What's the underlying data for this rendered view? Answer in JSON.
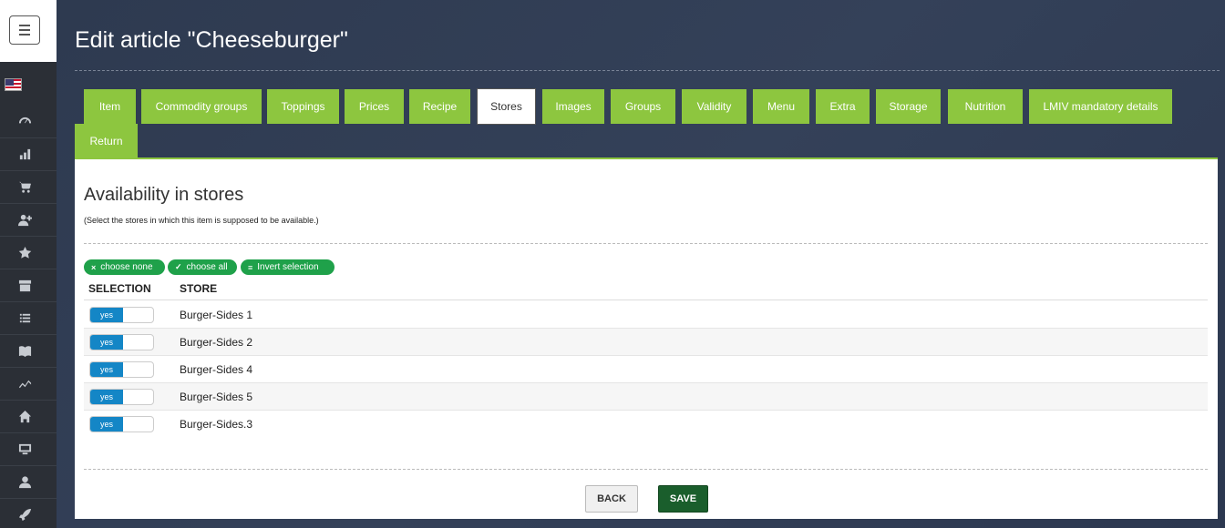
{
  "sidebar": {
    "language": "en-US",
    "items": [
      {
        "icon": "dashboard-icon"
      },
      {
        "icon": "bar-chart-icon"
      },
      {
        "icon": "cart-icon"
      },
      {
        "icon": "add-user-icon"
      },
      {
        "icon": "star-icon"
      },
      {
        "icon": "archive-icon"
      },
      {
        "icon": "list-icon"
      },
      {
        "icon": "book-icon"
      },
      {
        "icon": "trend-icon"
      },
      {
        "icon": "home-icon"
      },
      {
        "icon": "monitor-icon"
      },
      {
        "icon": "user-icon"
      },
      {
        "icon": "rocket-icon"
      }
    ]
  },
  "page": {
    "title": "Edit article \"Cheeseburger\""
  },
  "tabs": [
    {
      "label": "Item"
    },
    {
      "label": "Commodity groups"
    },
    {
      "label": "Toppings"
    },
    {
      "label": "Prices"
    },
    {
      "label": "Recipe"
    },
    {
      "label": "Stores",
      "active": true
    },
    {
      "label": "Images"
    },
    {
      "label": "Groups"
    },
    {
      "label": "Validity"
    },
    {
      "label": "Menu"
    },
    {
      "label": "Extra"
    },
    {
      "label": "Storage"
    },
    {
      "label": "Nutrition"
    },
    {
      "label": "LMIV mandatory details"
    },
    {
      "label": "Return"
    }
  ],
  "section": {
    "title": "Availability in stores",
    "hint": "(Select the stores in which this item is supposed to be available.)"
  },
  "actions": {
    "choose_none": {
      "icon": "×",
      "label": "choose none"
    },
    "choose_all": {
      "icon": "✓",
      "label": "choose all"
    },
    "invert": {
      "icon": "≡",
      "label": "Invert selection"
    }
  },
  "table": {
    "headers": {
      "selection": "SELECTION",
      "store": "STORE"
    },
    "rows": [
      {
        "toggle": "yes",
        "store": "Burger-Sides 1"
      },
      {
        "toggle": "yes",
        "store": "Burger-Sides 2"
      },
      {
        "toggle": "yes",
        "store": "Burger-Sides 4"
      },
      {
        "toggle": "yes",
        "store": "Burger-Sides 5"
      },
      {
        "toggle": "yes",
        "store": "Burger-Sides.3"
      }
    ]
  },
  "buttons": {
    "back": "BACK",
    "save": "SAVE"
  },
  "colors": {
    "tab_green": "#8dc63f",
    "pill_green": "#1fa14a",
    "toggle_blue": "#1486c6",
    "save_green": "#1a5e2c",
    "background": "#2f3a4e"
  }
}
